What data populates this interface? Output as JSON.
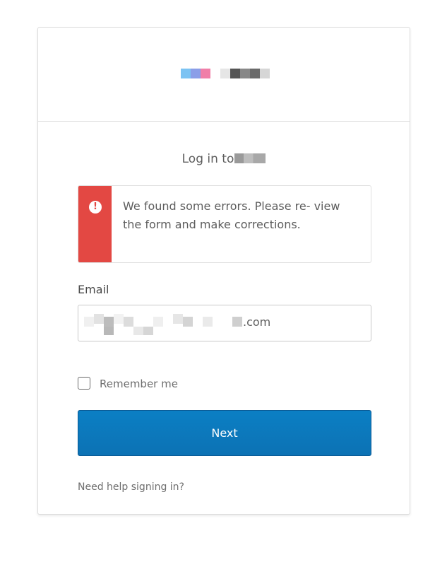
{
  "login": {
    "title": "Log in to",
    "error_message": "We found some errors. Please re- view the form and make corrections.",
    "email_label": "Email",
    "email_value_suffix": ".com",
    "remember_label": "Remember me",
    "next_label": "Next",
    "help_link": "Need help signing in?"
  },
  "icons": {
    "error": "exclamation-circle-icon",
    "error_glyph": "!"
  },
  "colors": {
    "primary_button": "#0c7bc0",
    "error_red": "#e34843",
    "border": "#dcdcdc",
    "text": "#5d5d5d"
  }
}
